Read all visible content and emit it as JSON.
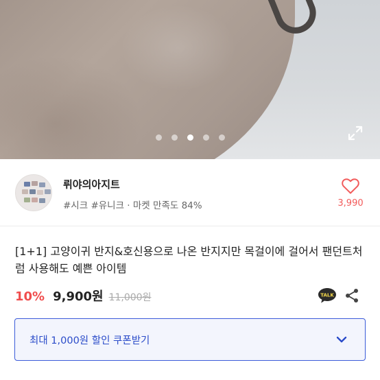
{
  "carousel": {
    "dot_count": 5,
    "active_index": 2
  },
  "shop": {
    "name": "뤼야의아지트",
    "tags": "#시크 #유니크 · 마켓 만족도 84%",
    "likes": "3,990"
  },
  "product": {
    "title": "[1+1] 고양이귀 반지&호신용으로 나온 반지지만 목걸이에 걸어서 팬던트처럼 사용해도 예쁜 아이템",
    "discount": "10%",
    "price": "9,900원",
    "original_price": "11,000원"
  },
  "talk_badge": "TALK",
  "coupon": {
    "label": "최대 1,000원 할인 쿠폰받기"
  },
  "colors": {
    "accent_red": "#f04d4d",
    "coupon_blue": "#3b5bd9",
    "coupon_bg": "#f3f5fd"
  },
  "icons": [
    "expand-icon",
    "heart-icon",
    "kakaotalk-icon",
    "share-icon",
    "chevron-down-icon"
  ]
}
